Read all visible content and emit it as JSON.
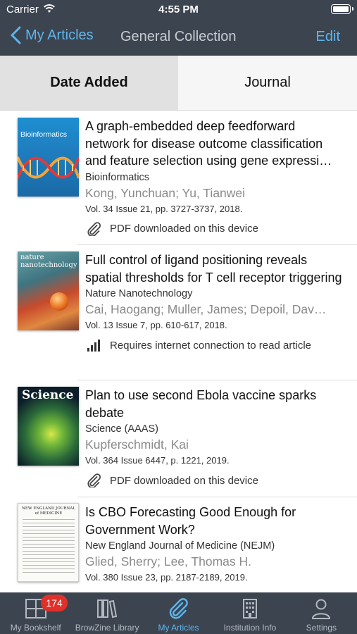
{
  "status_bar": {
    "carrier": "Carrier",
    "time": "4:55 PM"
  },
  "nav": {
    "back_label": "My Articles",
    "title": "General Collection",
    "edit_label": "Edit"
  },
  "segments": [
    {
      "label": "Date Added",
      "selected": true
    },
    {
      "label": "Journal",
      "selected": false
    }
  ],
  "articles": [
    {
      "title": "A graph-embedded deep feedforward network for disease outcome classification and feature selection using gene expressi…",
      "journal": "Bioinformatics",
      "authors": "Kong, Yunchuan; Yu, Tianwei",
      "citation": "Vol. 34 Issue 21, pp. 3727-3737, 2018.",
      "availability": "PDF downloaded on this device",
      "availability_icon": "paperclip-icon",
      "cover_text": "Bioinformatics"
    },
    {
      "title": "Full control of ligand positioning reveals spatial thresholds for T cell receptor triggering",
      "journal": "Nature Nanotechnology",
      "authors": "Cai, Haogang; Muller, James; Depoil, Dav…",
      "citation": "Vol. 13 Issue 7, pp. 610-617, 2018.",
      "availability": "Requires internet connection to read article",
      "availability_icon": "signal-bars-icon",
      "cover_text": "nature nanotechnology"
    },
    {
      "title": "Plan to use second Ebola vaccine sparks debate",
      "journal": "Science (AAAS)",
      "authors": "Kupferschmidt, Kai",
      "citation": "Vol. 364 Issue 6447, p. 1221, 2019.",
      "availability": "PDF downloaded on this device",
      "availability_icon": "paperclip-icon",
      "cover_text": "Science"
    },
    {
      "title": "Is CBO Forecasting Good Enough for Government Work?",
      "journal": "New England Journal of Medicine (NEJM)",
      "authors": "Glied, Sherry; Lee, Thomas H.",
      "citation": "Vol. 380 Issue 23, pp. 2187-2189, 2019.",
      "availability": "",
      "availability_icon": "",
      "cover_text": "NEW ENGLAND JOURNAL of MEDICINE"
    }
  ],
  "tabbar": [
    {
      "label": "My Bookshelf",
      "icon": "bookshelf-icon",
      "active": false,
      "badge": "174"
    },
    {
      "label": "BrowZine Library",
      "icon": "library-icon",
      "active": false
    },
    {
      "label": "My Articles",
      "icon": "paperclip-icon",
      "active": true
    },
    {
      "label": "Institution Info",
      "icon": "building-icon",
      "active": false
    },
    {
      "label": "Settings",
      "icon": "person-icon",
      "active": false
    }
  ],
  "colors": {
    "header_bg": "#3c4450",
    "accent": "#5cb6ee",
    "badge": "#e0302a"
  }
}
